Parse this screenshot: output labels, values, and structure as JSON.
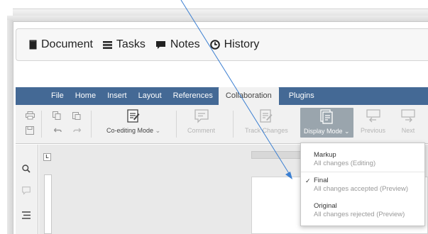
{
  "header": {
    "items": [
      {
        "label": "Document",
        "icon": "document-icon"
      },
      {
        "label": "Tasks",
        "icon": "tasks-icon"
      },
      {
        "label": "Notes",
        "icon": "notes-icon"
      },
      {
        "label": "History",
        "icon": "history-icon"
      }
    ]
  },
  "menubar": {
    "tabs": [
      "File",
      "Home",
      "Insert",
      "Layout",
      "References",
      "Collaboration",
      "Plugins"
    ],
    "active": "Collaboration"
  },
  "toolbar": {
    "coediting_label": "Co-editing Mode",
    "comment_label": "Comment",
    "track_changes_label": "Track Changes",
    "display_mode_label": "Display Mode",
    "previous_label": "Previous",
    "next_label": "Next"
  },
  "ruler": {
    "corner": "L"
  },
  "dropdown": {
    "items": [
      {
        "title": "Markup",
        "subtitle": "All changes (Editing)",
        "checked": false
      },
      {
        "title": "Final",
        "subtitle": "All changes accepted (Preview)",
        "checked": true
      },
      {
        "title": "Original",
        "subtitle": "All changes rejected (Preview)",
        "checked": false
      }
    ]
  },
  "page": {
    "partial_char": "l"
  },
  "colors": {
    "menubar": "#446995",
    "arrow": "#3b7fd1",
    "toolbar": "#f1f1f1"
  }
}
